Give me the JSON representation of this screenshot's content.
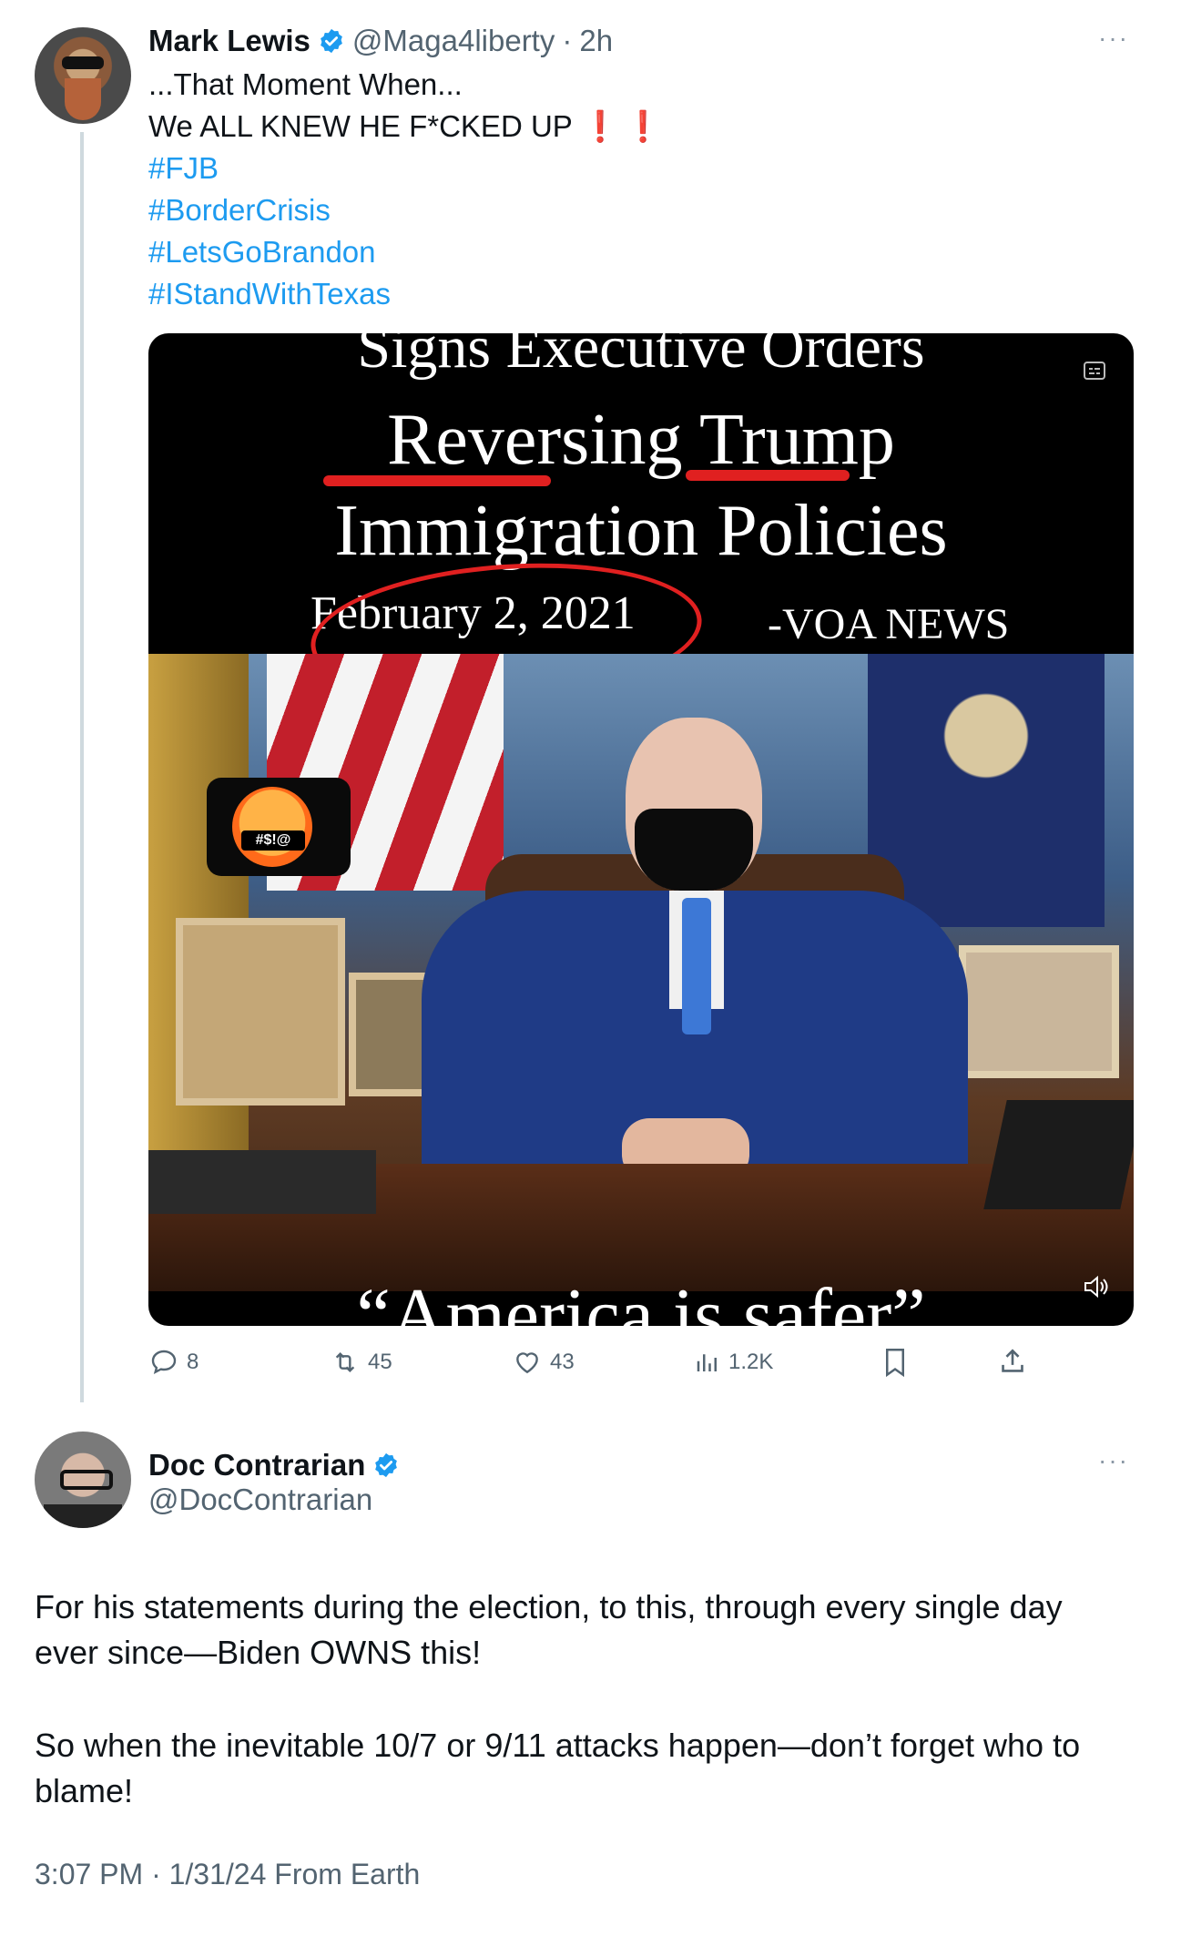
{
  "tweet1": {
    "author_name": "Mark Lewis",
    "handle": "@Maga4liberty",
    "separator": "·",
    "time": "2h",
    "more": "···",
    "lines": [
      "...That Moment When...",
      "We ALL KNEW HE F*CKED UP"
    ],
    "exclaim": "❗❗",
    "hashtags": [
      "#FJB",
      "#BorderCrisis",
      "#LetsGoBrandon",
      "#IStandWithTexas"
    ],
    "video": {
      "headline_top": "Signs Executive Orders",
      "headline_1": "Reversing Trump",
      "headline_2": "Immigration Policies",
      "date": "February 2, 2021",
      "source": "-VOA NEWS",
      "emoji_text": "#$!@",
      "subtitle": "“America is safer”",
      "icons": [
        "captions-icon",
        "volume-icon"
      ]
    },
    "actions": {
      "replies": "8",
      "retweets": "45",
      "likes": "43",
      "views": "1.2K"
    }
  },
  "tweet2": {
    "author_name": "Doc Contrarian",
    "handle": "@DocContrarian",
    "more": "···",
    "paragraph1": "For his statements during the election, to this, through every single day ever since—Biden OWNS this!",
    "paragraph2": "So when the inevitable 10/7 or 9/11 attacks happen—don’t forget who to blame!",
    "timestamp": "3:07 PM · 1/31/24 From Earth"
  },
  "colors": {
    "link": "#1d9bf0",
    "verified": "#1d9bf0",
    "muted": "#536471",
    "exclaim": "#e0245e"
  }
}
